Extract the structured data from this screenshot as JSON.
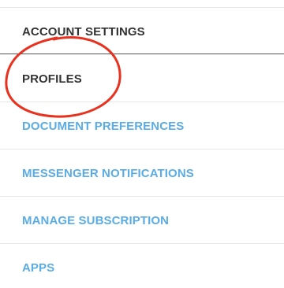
{
  "menu": {
    "items": [
      {
        "label": "ACCOUNT SETTINGS"
      },
      {
        "label": "PROFILES"
      },
      {
        "label": "DOCUMENT PREFERENCES"
      },
      {
        "label": "MESSENGER NOTIFICATIONS"
      },
      {
        "label": "MANAGE SUBSCRIPTION"
      },
      {
        "label": "APPS"
      }
    ]
  },
  "colors": {
    "active_text": "#333333",
    "link_text": "#5aace4",
    "annotation_circle": "#e8321f"
  }
}
